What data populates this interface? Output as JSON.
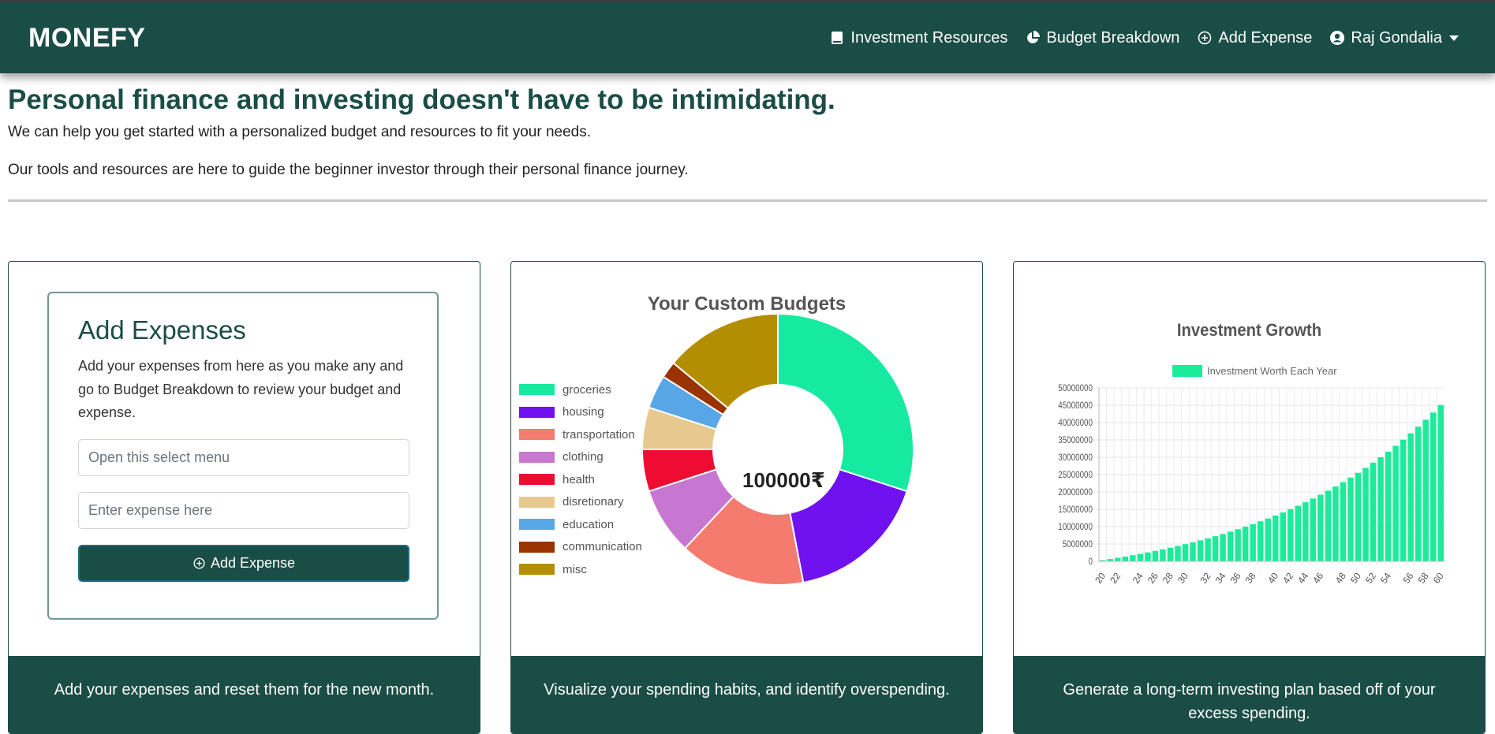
{
  "nav": {
    "brand": "MONEFY",
    "links": [
      {
        "label": "Investment Resources",
        "icon": "book-icon"
      },
      {
        "label": "Budget Breakdown",
        "icon": "pie-chart-icon"
      },
      {
        "label": "Add Expense",
        "icon": "plus-circle-icon"
      },
      {
        "label": "Raj Gondalia",
        "icon": "user-circle-icon"
      }
    ]
  },
  "hero": {
    "title": "Personal finance and investing doesn't have to be intimidating.",
    "line1": "We can help you get started with a personalized budget and resources to fit your needs.",
    "line2": "Our tools and resources are here to guide the beginner investor through their personal finance journey."
  },
  "add_card": {
    "heading": "Add Expenses",
    "description": "Add your expenses from here as you make any and go to Budget Breakdown to review your budget and expense.",
    "select_placeholder": "Open this select menu",
    "input_placeholder": "Enter expense here",
    "button_label": "Add Expense",
    "footer": "Add your expenses and reset them for the new month."
  },
  "budget_card": {
    "footer": "Visualize your spending habits, and identify overspending."
  },
  "investment_card": {
    "footer": "Generate a long-term investing plan based off of your excess spending."
  },
  "chart_data": [
    {
      "type": "pie",
      "title": "Your Custom Budgets",
      "center_label": "100000₹",
      "categories": [
        "groceries",
        "housing",
        "transportation",
        "clothing",
        "health",
        "disretionary",
        "education",
        "communication",
        "misc"
      ],
      "values": [
        30,
        17,
        15,
        8,
        5,
        5,
        4,
        2,
        14
      ],
      "colors": [
        "#16eaa0",
        "#7012f0",
        "#f47b6d",
        "#c777cf",
        "#f00b32",
        "#e7c88f",
        "#58a6e6",
        "#993300",
        "#b38e00"
      ],
      "legend_position": "left"
    },
    {
      "type": "bar",
      "title": "Investment Growth",
      "series": [
        {
          "name": "Investment Worth Each Year",
          "color": "#1ceb9a",
          "values": [
            325000,
            665000,
            1010000,
            1380000,
            1760000,
            2160000,
            2580000,
            3010000,
            3470000,
            3940000,
            4440000,
            4950000,
            5490000,
            6050000,
            6640000,
            7250000,
            7890000,
            8560000,
            9250000,
            9980000,
            10740000,
            11530000,
            12350000,
            13210000,
            14110000,
            15040000,
            16020000,
            17040000,
            18100000,
            19210000,
            20370000,
            21580000,
            22840000,
            24150000,
            25520000,
            26950000,
            28440000,
            30000000,
            31620000,
            33310000,
            35070000,
            36910000,
            38820000,
            40820000,
            42900000,
            45070000
          ]
        }
      ],
      "categories_first": 20,
      "categories_last": 60,
      "x_tick_labels": [
        "20",
        "22",
        "24",
        "26",
        "28",
        "30",
        "32",
        "34",
        "36",
        "38",
        "40",
        "42",
        "44",
        "46",
        "48",
        "50",
        "52",
        "54",
        "56",
        "58",
        "60"
      ],
      "y_tick_labels": [
        "0",
        "5000000",
        "10000000",
        "15000000",
        "20000000",
        "25000000",
        "30000000",
        "35000000",
        "40000000",
        "45000000",
        "50000000"
      ],
      "ylim": [
        0,
        50000000
      ],
      "grid": true,
      "legend_position": "top"
    }
  ]
}
